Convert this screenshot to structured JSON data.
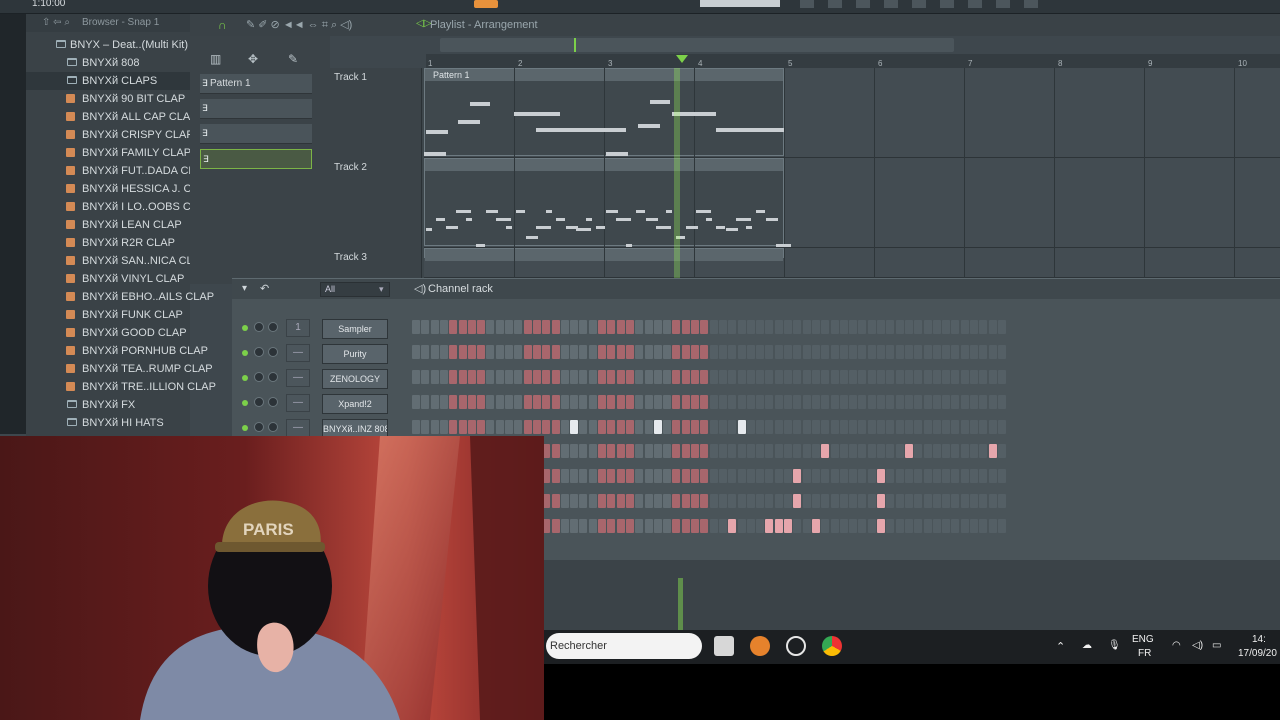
{
  "top": {
    "time": "1:10:00"
  },
  "browser": {
    "title": "Browser - Snap 1",
    "items": [
      {
        "label": "BNYX – Deat..(Multi Kit)",
        "kind": "folder",
        "level": 1
      },
      {
        "label": "BNYXй 808",
        "kind": "folder",
        "level": 2
      },
      {
        "label": "BNYXй  CLAPS",
        "kind": "folder",
        "level": 2,
        "selected": true
      },
      {
        "label": "BNYXй  90 BIT CLAP",
        "kind": "file"
      },
      {
        "label": "BNYXй  ALL CAP CLAP",
        "kind": "file"
      },
      {
        "label": "BNYXй  CRISPY CLAP",
        "kind": "file"
      },
      {
        "label": "BNYXй  FAMILY CLAP",
        "kind": "file"
      },
      {
        "label": "BNYXй  FUT..DADA CLAP",
        "kind": "file"
      },
      {
        "label": "BNYXй  HESSICA J. CLAP",
        "kind": "file"
      },
      {
        "label": "BNYXй  I LO..OOBS CLAP",
        "kind": "file"
      },
      {
        "label": "BNYXй  LEAN CLAP",
        "kind": "file"
      },
      {
        "label": "BNYXй  R2R CLAP",
        "kind": "file"
      },
      {
        "label": "BNYXй  SAN..NICA CLAP",
        "kind": "file"
      },
      {
        "label": "BNYXй  VINYL CLAP",
        "kind": "file"
      },
      {
        "label": "BNYXй  EBHO..AILS CLAP",
        "kind": "file"
      },
      {
        "label": "BNYXй  FUNK CLAP",
        "kind": "file"
      },
      {
        "label": "BNYXй  GOOD CLAP",
        "kind": "file"
      },
      {
        "label": "BNYXй  PORNHUB CLAP",
        "kind": "file"
      },
      {
        "label": "BNYXй  TEA..RUMP CLAP",
        "kind": "file"
      },
      {
        "label": "BNYXй  TRE..ILLION CLAP",
        "kind": "file"
      },
      {
        "label": "BNYXй  FX",
        "kind": "folder",
        "level": 2
      },
      {
        "label": "BNYXй  HI HATS",
        "kind": "folder",
        "level": 2
      }
    ]
  },
  "patterns": [
    {
      "label": "Pattern 1"
    },
    {
      "label": ""
    },
    {
      "label": ""
    },
    {
      "label": "",
      "selected": true
    }
  ],
  "playlist": {
    "title": "Playlist - Arrangement",
    "ruler": [
      "1",
      "2",
      "3",
      "4",
      "5",
      "6",
      "7",
      "8",
      "9",
      "10"
    ],
    "tracks": [
      "Track 1",
      "Track 2",
      "Track 3"
    ],
    "clip_label": "Pattern 1"
  },
  "channel_rack": {
    "title": "Channel rack",
    "filter": "All",
    "channels": [
      {
        "name": "Sampler",
        "num": "1"
      },
      {
        "name": "Purity",
        "num": "—"
      },
      {
        "name": "ZENOLOGY",
        "num": "—"
      },
      {
        "name": "Xpand!2",
        "num": "—"
      },
      {
        "name": "BNYXй..INZ 808",
        "num": "—"
      }
    ]
  },
  "taskbar": {
    "search_placeholder": "Rechercher",
    "lang1": "ENG",
    "lang2": "FR",
    "time": "14:",
    "date": "17/09/20"
  },
  "colors": {
    "accent_green": "#7cd04a",
    "step_red": "#c07a80",
    "bg": "#3e474d"
  }
}
